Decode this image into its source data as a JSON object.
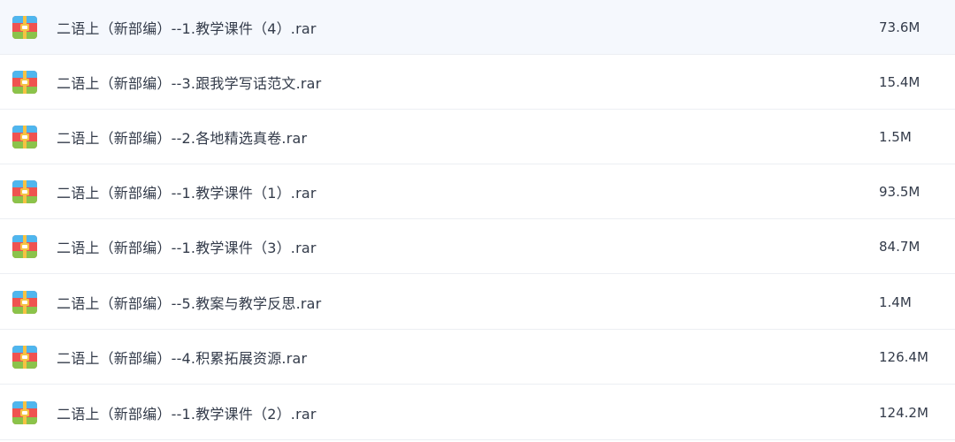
{
  "file_list": {
    "icon": "rar-archive-icon",
    "files": [
      {
        "name": "二语上（新部编）--1.教学课件（4）.rar",
        "size": "73.6M"
      },
      {
        "name": "二语上（新部编）--3.跟我学写话范文.rar",
        "size": "15.4M"
      },
      {
        "name": "二语上（新部编）--2.各地精选真卷.rar",
        "size": "1.5M"
      },
      {
        "name": "二语上（新部编）--1.教学课件（1）.rar",
        "size": "93.5M"
      },
      {
        "name": "二语上（新部编）--1.教学课件（3）.rar",
        "size": "84.7M"
      },
      {
        "name": "二语上（新部编）--5.教案与教学反思.rar",
        "size": "1.4M"
      },
      {
        "name": "二语上（新部编）--4.积累拓展资源.rar",
        "size": "126.4M"
      },
      {
        "name": "二语上（新部编）--1.教学课件（2）.rar",
        "size": "124.2M"
      }
    ]
  },
  "colors": {
    "icon_top": "#4fb6ee",
    "icon_middle": "#ef5350",
    "icon_bottom": "#8bc34a",
    "icon_band": "#f5c242",
    "row_divider": "#eceff3",
    "text": "#333b4a"
  }
}
